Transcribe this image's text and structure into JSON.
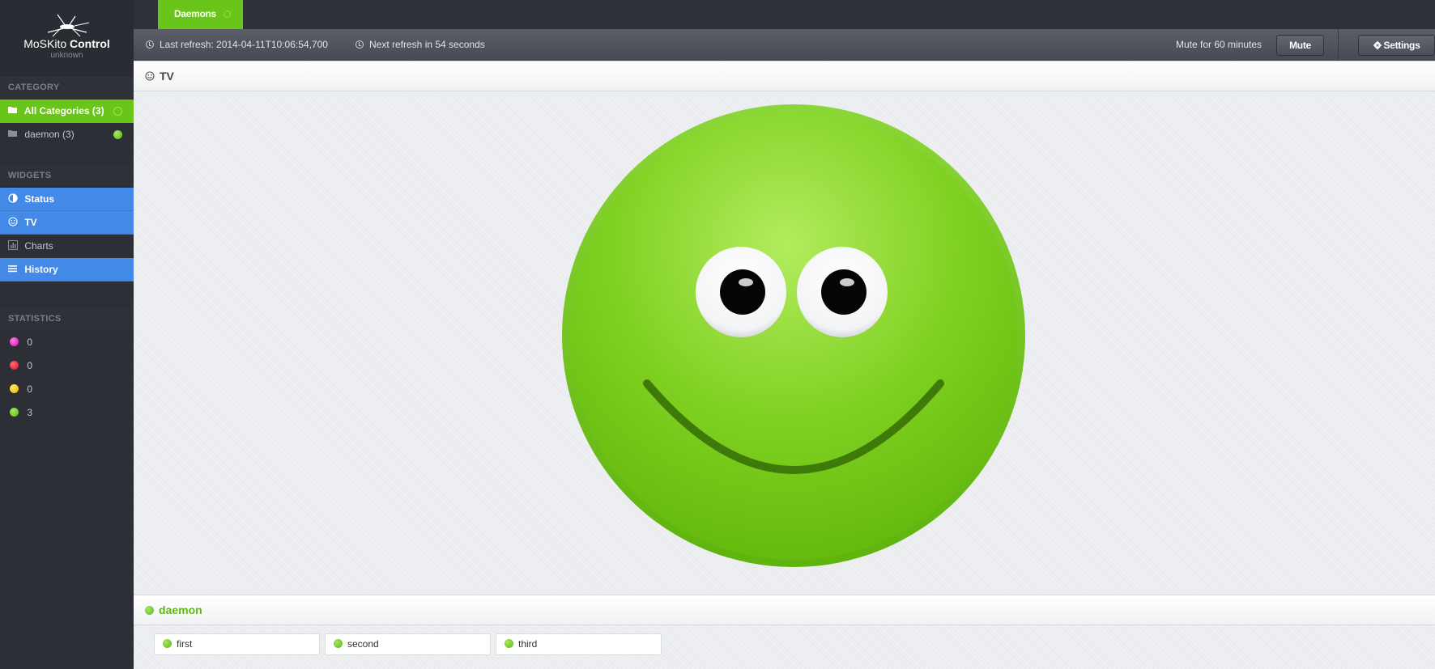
{
  "app": {
    "name": "MoSKito",
    "name_bold": "Control",
    "subtitle": "unknown"
  },
  "colors": {
    "green": "#6ac51a",
    "blue": "#4289e8",
    "magenta": "#e21db8",
    "red": "#e0182a",
    "yellow": "#f4c400"
  },
  "sidebar": {
    "category_head": "CATEGORY",
    "categories": [
      {
        "label": "All Categories (3)",
        "active": true,
        "icon": "folder-open-icon"
      },
      {
        "label": "daemon (3)",
        "active": false,
        "icon": "folder-icon"
      }
    ],
    "widgets_head": "WIDGETS",
    "widgets": [
      {
        "label": "Status",
        "icon": "half-circle-icon",
        "active": true
      },
      {
        "label": "TV",
        "icon": "smiley-icon",
        "active": true
      },
      {
        "label": "Charts",
        "icon": "bar-chart-icon",
        "active": false
      },
      {
        "label": "History",
        "icon": "list-icon",
        "active": true
      }
    ],
    "statistics_head": "STATISTICS",
    "statistics": [
      {
        "color": "magenta",
        "value": "0"
      },
      {
        "color": "red",
        "value": "0"
      },
      {
        "color": "yellow",
        "value": "0"
      },
      {
        "color": "green",
        "value": "3"
      }
    ]
  },
  "tabs": [
    {
      "label": "Daemons"
    }
  ],
  "toolbar": {
    "last_refresh": "Last refresh: 2014-04-11T10:06:54,700",
    "next_refresh": "Next refresh in 54 seconds",
    "mute_text": "Mute for 60 minutes",
    "mute_label": "Mute",
    "settings_label": "Settings"
  },
  "main": {
    "tv_title": "TV",
    "daemon_title": "daemon",
    "components": [
      {
        "label": "first"
      },
      {
        "label": "second"
      },
      {
        "label": "third"
      }
    ]
  }
}
